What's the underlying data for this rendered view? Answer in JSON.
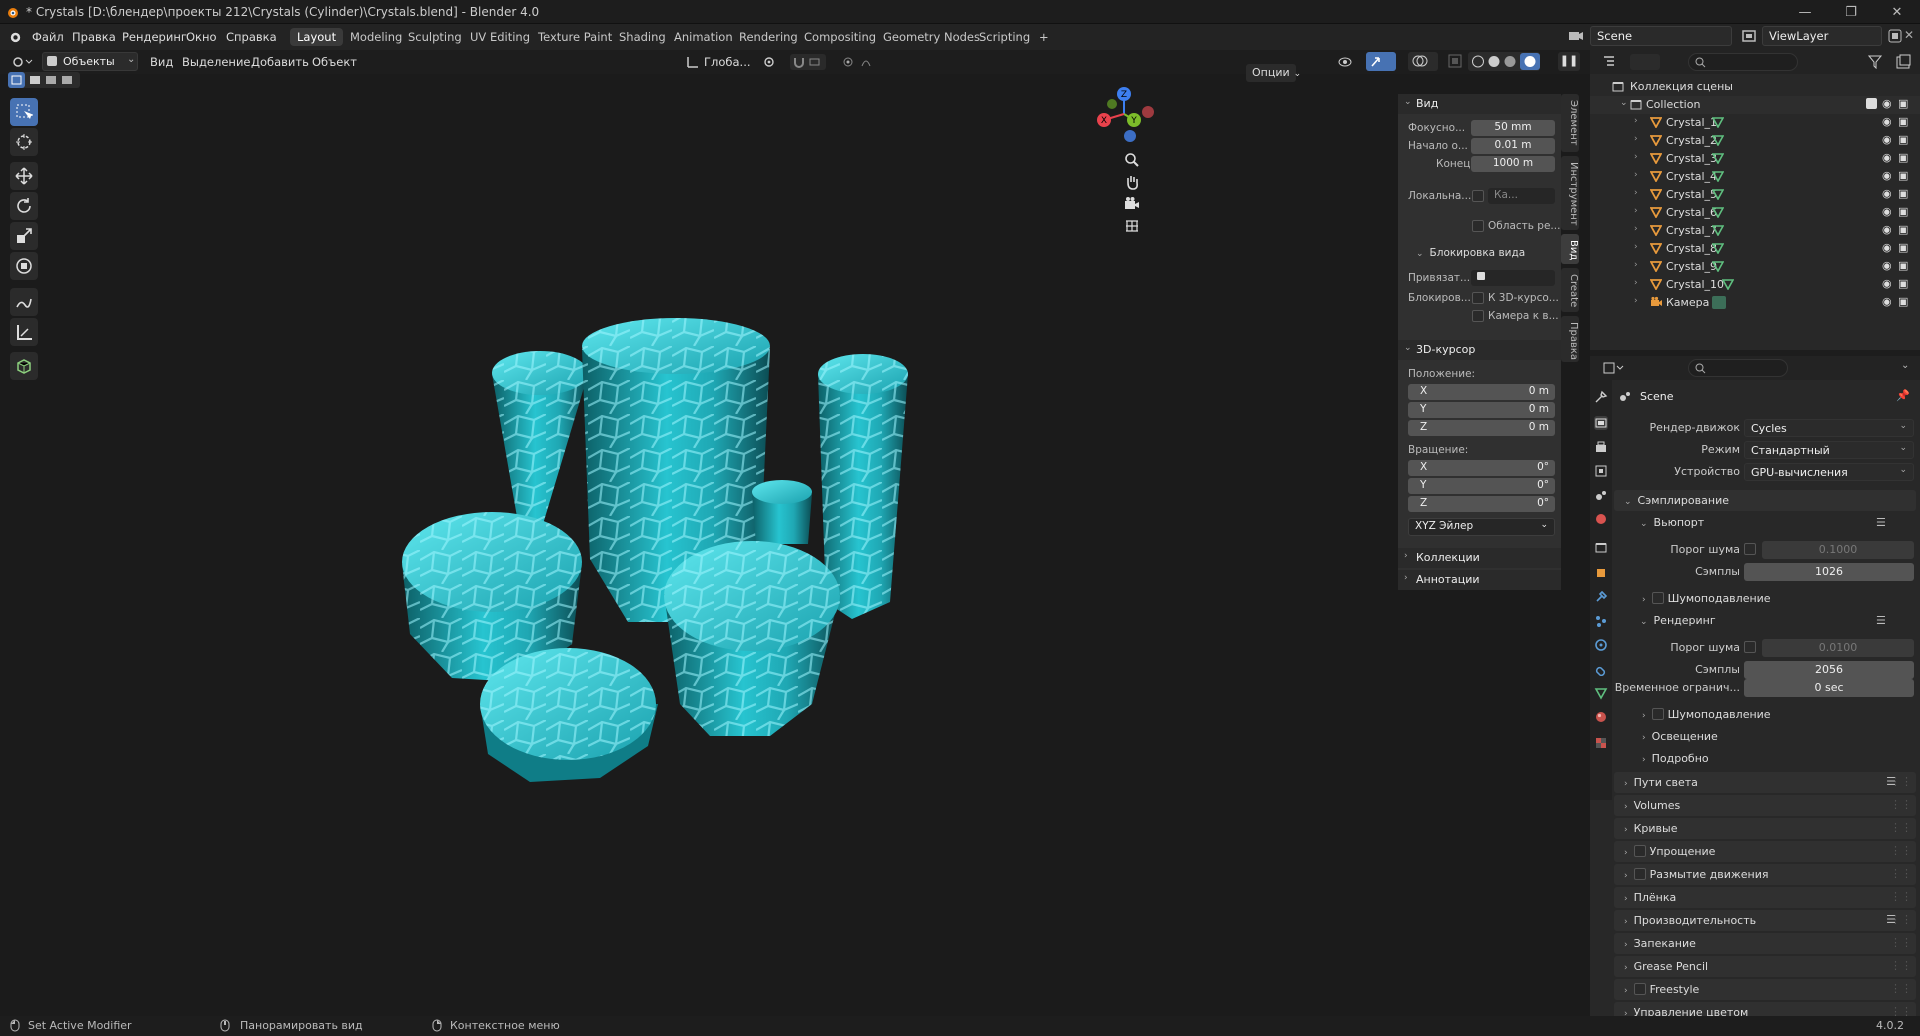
{
  "window": {
    "title": "* Crystals [D:\\блендер\\проекты 212\\Crystals (Cylinder)\\Crystals.blend] - Blender 4.0"
  },
  "menu": [
    "Файл",
    "Правка",
    "Рендеринг",
    "Окно",
    "Справка"
  ],
  "workspaces": [
    "Layout",
    "Modeling",
    "Sculpting",
    "UV Editing",
    "Texture Paint",
    "Shading",
    "Animation",
    "Rendering",
    "Compositing",
    "Geometry Nodes",
    "Scripting",
    "+"
  ],
  "scene": {
    "name": "Scene",
    "view_layer": "ViewLayer"
  },
  "viewport_header": {
    "mode": "Объекты",
    "items": [
      "Вид",
      "Выделение",
      "Добавить",
      "Объект"
    ],
    "orientation": "Глоба...",
    "options": "Опции"
  },
  "npanel": {
    "view_header": "Вид",
    "focal_label": "Фокусно...",
    "focal_value": "50 mm",
    "clip_start_label": "Начало о...",
    "clip_start_value": "0.01 m",
    "clip_end_label": "Конец",
    "clip_end_value": "1000 m",
    "local_label": "Локальна...",
    "local_value": "Ка...",
    "region_label": "Область ре...",
    "lock_header": "Блокировка вида",
    "bind_label": "Привязат...",
    "lock_label": "Блокиров...",
    "lock_3d": "К 3D-курсо...",
    "lock_cam": "Камера к в...",
    "cursor_header": "3D-курсор",
    "location_label": "Положение:",
    "loc": [
      {
        "axis": "X",
        "value": "0 m"
      },
      {
        "axis": "Y",
        "value": "0 m"
      },
      {
        "axis": "Z",
        "value": "0 m"
      }
    ],
    "rotation_label": "Вращение:",
    "rot": [
      {
        "axis": "X",
        "value": "0°"
      },
      {
        "axis": "Y",
        "value": "0°"
      },
      {
        "axis": "Z",
        "value": "0°"
      }
    ],
    "rot_mode": "XYZ Эйлер",
    "collections": "Коллекции",
    "annotations": "Аннотации"
  },
  "sidebar_tabs": [
    "Элемент",
    "Инструмент",
    "Вид",
    "Create",
    "Правка"
  ],
  "outliner": {
    "scene_collection": "Коллекция сцены",
    "collection": "Collection",
    "objects": [
      "Crystal_1",
      "Crystal_2",
      "Crystal_3",
      "Crystal_4",
      "Crystal_5",
      "Crystal_6",
      "Crystal_7",
      "Crystal_8",
      "Crystal_9",
      "Crystal_10",
      "Камера"
    ]
  },
  "properties": {
    "scene": "Scene",
    "render_engine_label": "Рендер-движок",
    "render_engine": "Cycles",
    "mode_label": "Режим",
    "mode": "Стандартный",
    "device_label": "Устройство",
    "device": "GPU-вычисления",
    "sampling": "Сэмплирование",
    "viewport": "Вьюпорт",
    "noise_label": "Порог шума",
    "viewport_noise": "0.1000",
    "samples_label": "Сэмплы",
    "viewport_samples": "1026",
    "denoise": "Шумоподавление",
    "render": "Рендеринг",
    "render_noise": "0.0100",
    "render_samples": "2056",
    "time_limit_label": "Временное огранич...",
    "time_limit": "0 sec",
    "lights": "Освещение",
    "advanced": "Подробно",
    "sections": [
      "Пути света",
      "Volumes",
      "Кривые",
      "Упрощение",
      "Размытие движения",
      "Плёнка",
      "Производительность",
      "Запекание",
      "Grease Pencil",
      "Freestyle",
      "Управление цветом"
    ]
  },
  "status": {
    "left": "Set Active Modifier",
    "mid": "Панорамировать вид",
    "right": "Контекстное меню",
    "version": "4.0.2"
  },
  "colors": {
    "accent": "#4772b3",
    "crystal": "#1fc8d6",
    "orange": "#e89a3c",
    "green": "#5fbf7f"
  }
}
